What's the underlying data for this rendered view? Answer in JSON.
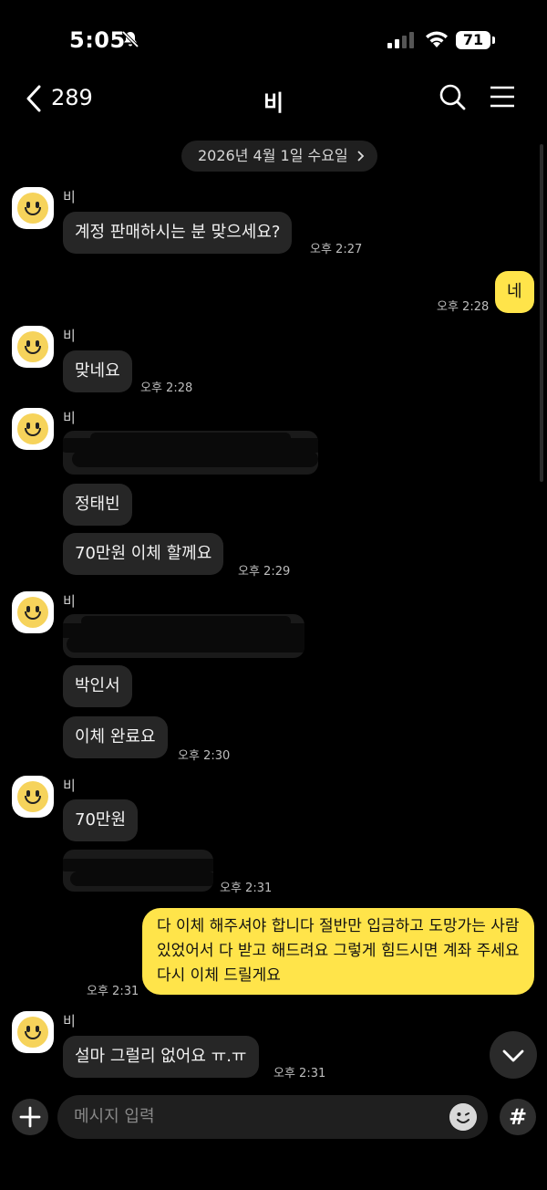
{
  "status_bar": {
    "time": "5:05",
    "battery": "71"
  },
  "header": {
    "back_count": "289",
    "title": "비"
  },
  "date_divider": "2026년 4월 1일 수요일",
  "messages": {
    "m1_sender": "비",
    "m1_text": "계정 판매하시는 분 맞으세요?",
    "m1_time": "오후 2:27",
    "m2_text": "네",
    "m2_time": "오후 2:28",
    "m3_sender": "비",
    "m3_text": "맞네요",
    "m3_time": "오후 2:28",
    "m4_sender": "비",
    "m4_name": "정태빈",
    "m4_text": "70만원 이체 할께요",
    "m4_time": "오후 2:29",
    "m5_sender": "비",
    "m5_name": "박인서",
    "m5_text": "이체 완료요",
    "m5_time": "오후 2:30",
    "m6_sender": "비",
    "m6_text": "70만원",
    "m6_time": "오후 2:31",
    "m7_text": "다 이체 해주셔야 합니다 절반만 입금하고 도망가는 사람 있었어서 다 받고 해드려요 그렇게 힘드시면 계좌 주세요 다시 이체 드릴게요",
    "m7_time": "오후 2:31",
    "m8_sender": "비",
    "m8_text": "설마 그럴리 없어요 ㅠ.ㅠ",
    "m8_time": "오후 2:31"
  },
  "input": {
    "placeholder": "메시지 입력",
    "hash_label": "#"
  },
  "colors": {
    "background": "#000000",
    "my_bubble": "#ffe44a",
    "their_bubble": "#262626"
  },
  "icons": [
    "silent-bell-icon",
    "signal-icon",
    "wifi-icon",
    "back-chevron-icon",
    "search-icon",
    "menu-icon",
    "smiley-avatar-icon",
    "plus-icon",
    "emoji-icon",
    "chevron-down-icon"
  ]
}
